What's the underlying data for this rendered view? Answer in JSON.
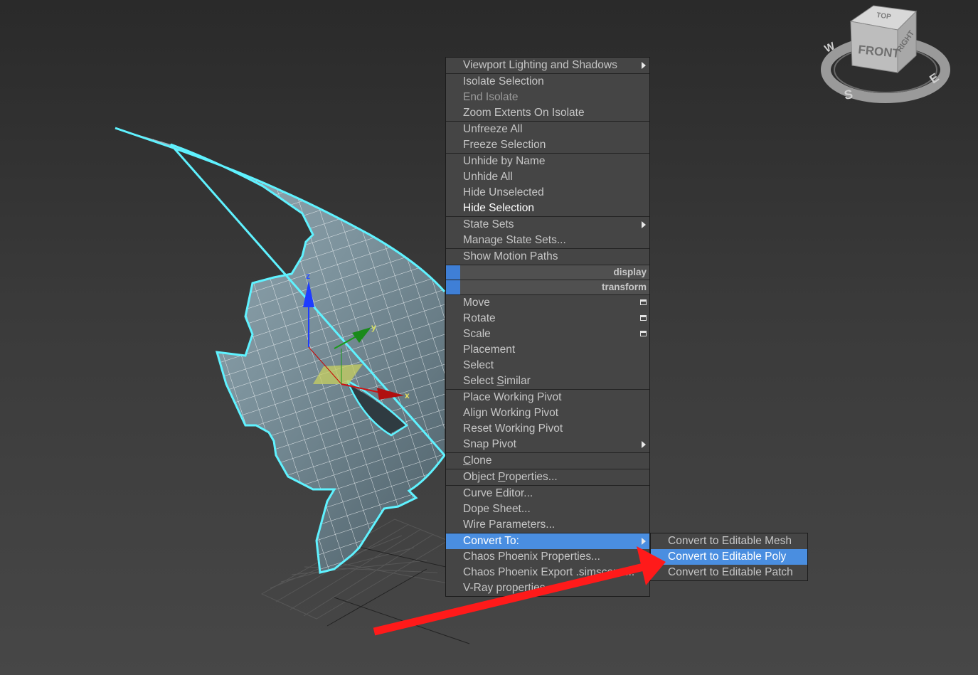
{
  "viewcube": {
    "front": "FRONT",
    "right": "RIGHT",
    "top": "TOP",
    "compass": [
      "W",
      "S",
      "E"
    ]
  },
  "gizmo": {
    "x": "x",
    "y": "y",
    "z": "z"
  },
  "menu": {
    "groups": [
      [
        {
          "label": "Viewport Lighting and Shadows",
          "submenu": true
        }
      ],
      [
        {
          "label": "Isolate Selection"
        },
        {
          "label": "End Isolate",
          "state": "dim"
        },
        {
          "label": "Zoom Extents On Isolate"
        }
      ],
      [
        {
          "label": "Unfreeze All"
        },
        {
          "label": "Freeze Selection"
        }
      ],
      [
        {
          "label": "Unhide by Name"
        },
        {
          "label": "Unhide All"
        },
        {
          "label": "Hide Unselected"
        },
        {
          "label": "Hide Selection",
          "state": "bright"
        }
      ],
      [
        {
          "label": "State Sets",
          "submenu": true
        },
        {
          "label": "Manage State Sets..."
        }
      ],
      [
        {
          "label": "Show Motion Paths"
        }
      ]
    ],
    "quad_headers": [
      "display",
      "transform"
    ],
    "transform_groups": [
      [
        {
          "label": "Move",
          "option": true
        },
        {
          "label": "Rotate",
          "option": true
        },
        {
          "label": "Scale",
          "option": true
        },
        {
          "label": "Placement"
        },
        {
          "label": "Select"
        },
        {
          "label": "Select Similar",
          "u": 7
        }
      ],
      [
        {
          "label": "Place Working Pivot"
        },
        {
          "label": "Align Working Pivot"
        },
        {
          "label": "Reset Working Pivot"
        },
        {
          "label": "Snap Pivot",
          "submenu": true
        }
      ],
      [
        {
          "label": "Clone",
          "u": 0
        }
      ],
      [
        {
          "label": "Object Properties...",
          "u": 7
        }
      ],
      [
        {
          "label": "Curve Editor..."
        },
        {
          "label": "Dope Sheet..."
        },
        {
          "label": "Wire Parameters..."
        }
      ],
      [
        {
          "label": "Convert To:",
          "submenu": true,
          "state": "hl"
        },
        {
          "label": "Chaos Phoenix Properties..."
        },
        {
          "label": "Chaos Phoenix Export .simscene..."
        },
        {
          "label": "V-Ray properties"
        }
      ]
    ]
  },
  "submenu": {
    "items": [
      {
        "label": "Convert to Editable Mesh"
      },
      {
        "label": "Convert to Editable Poly",
        "state": "hl"
      },
      {
        "label": "Convert to Editable Patch"
      }
    ]
  },
  "colors": {
    "highlight": "#4a8ee0",
    "selection_outline": "#5ff2ff",
    "annotation_arrow": "#ff1a1a"
  }
}
